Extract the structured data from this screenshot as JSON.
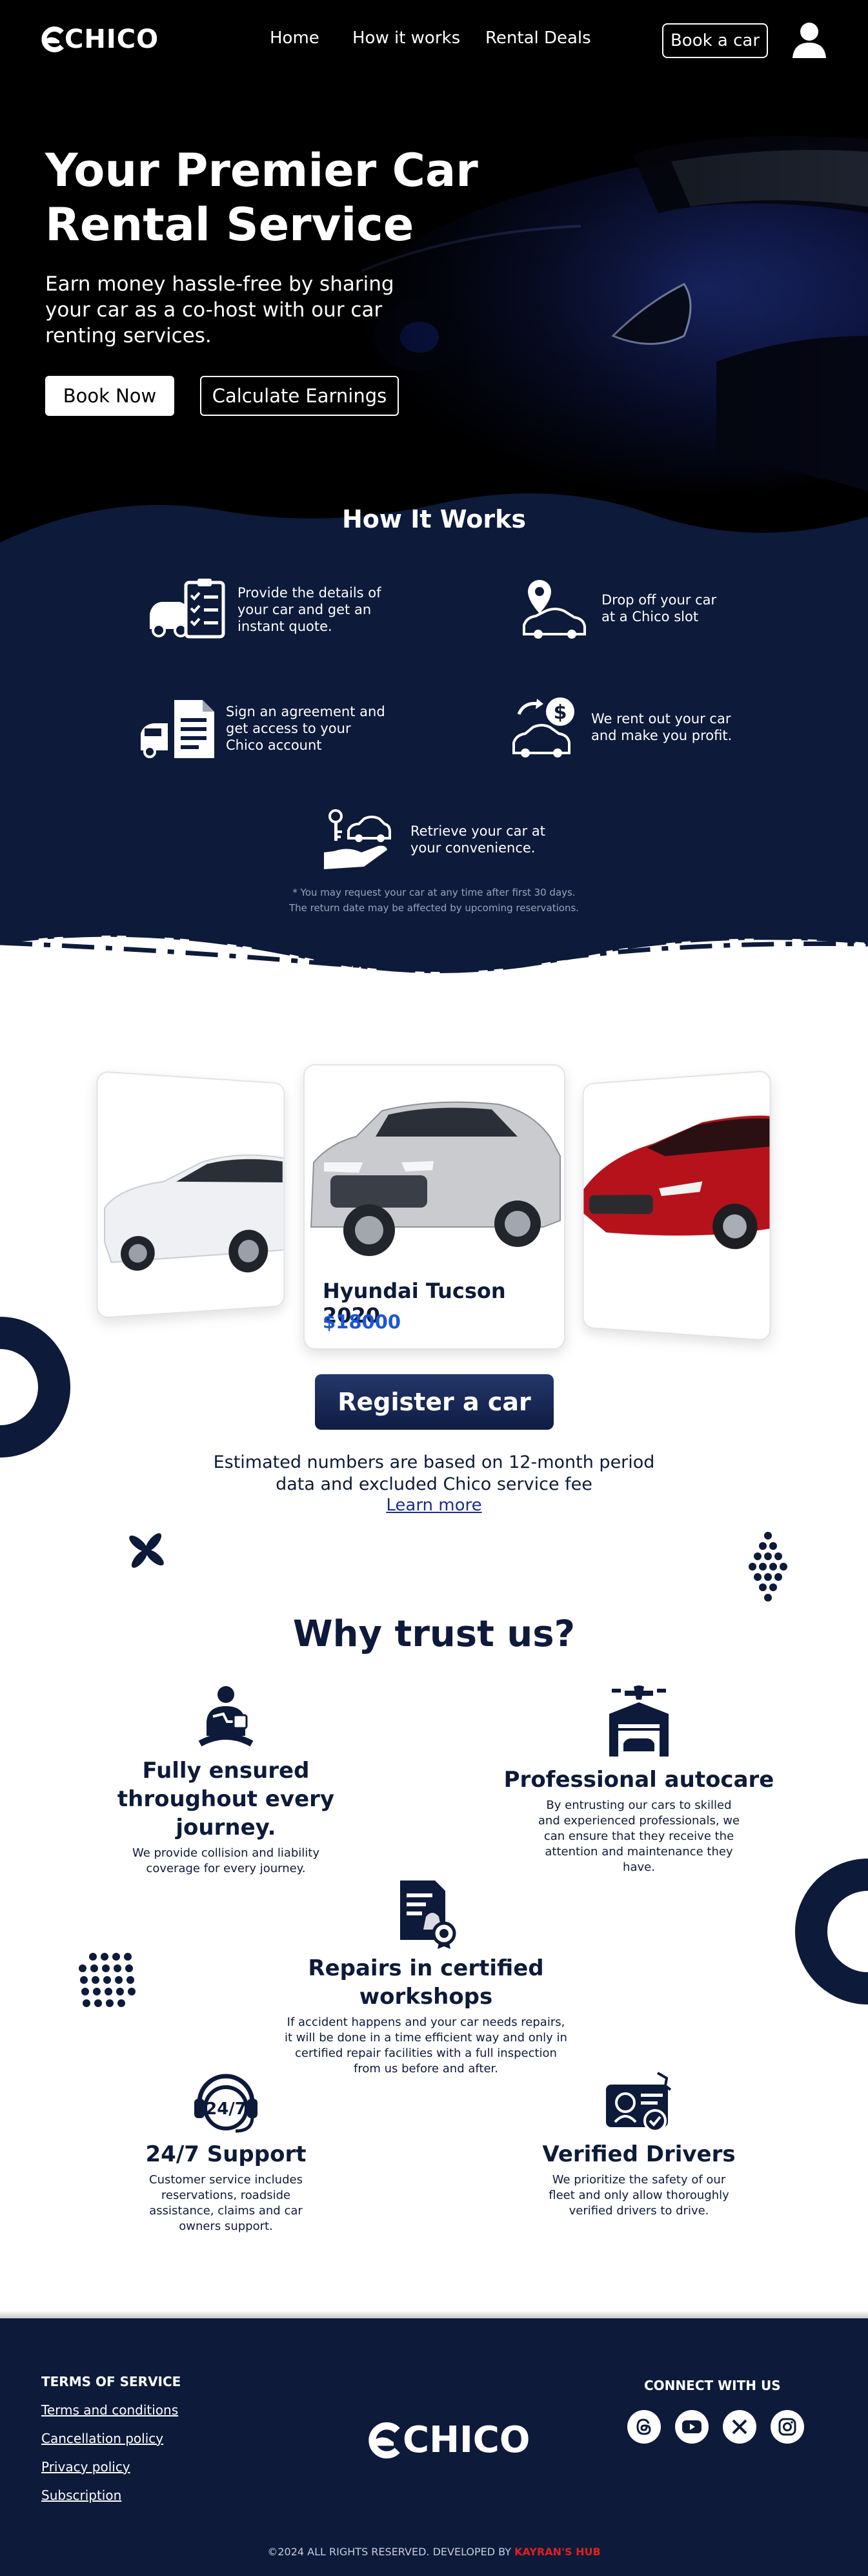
{
  "brand": {
    "name": "CHICO"
  },
  "nav": {
    "home": "Home",
    "how_it_works": "How it works",
    "rental_deals": "Rental Deals",
    "book_a_car": "Book a car"
  },
  "hero": {
    "title_line1": "Your Premier Car",
    "title_line2": "Rental Service",
    "subtitle": "Earn money hassle-free by sharing your car as a co-host with our car renting services.",
    "book_now": "Book Now",
    "calculate": "Calculate Earnings"
  },
  "how": {
    "title": "How It Works",
    "steps": [
      {
        "icon": "car-checklist-icon",
        "text": "Provide the details of your car and get an instant quote."
      },
      {
        "icon": "location-car-icon",
        "text": "Drop off your car at a Chico slot"
      },
      {
        "icon": "agreement-document-icon",
        "text": "Sign an agreement and get access to your Chico account"
      },
      {
        "icon": "car-money-icon",
        "text": "We rent out your car and make you profit."
      },
      {
        "icon": "key-hand-car-icon",
        "text": "Retrieve your car at your convenience."
      }
    ],
    "note_line1": "* You may request your car at any time after first 30 days.",
    "note_line2": "The return date may be affected by upcoming reservations."
  },
  "carousel": {
    "active_name": "Hyundai Tucson 2020",
    "active_price": "$18000",
    "colors": {
      "left": "#f2f3f5",
      "middle": "#c9cbcf",
      "right": "#b5121b"
    }
  },
  "register": {
    "button": "Register a car",
    "estimate": "Estimated numbers are based on 12-month period data and excluded Chico service fee",
    "learn_more": "Learn more"
  },
  "why": {
    "title": "Why trust us?",
    "features": [
      {
        "icon": "insured-person-icon",
        "title": "Fully ensured throughout every journey.",
        "desc": "We provide collision and liability coverage for every journey."
      },
      {
        "icon": "autocare-garage-icon",
        "title": "Professional autocare",
        "desc": "By entrusting our cars to skilled and experienced professionals, we can ensure that they receive the attention and maintenance they have."
      },
      {
        "icon": "certified-document-icon",
        "title": "Repairs in certified workshops",
        "desc": "If accident happens and your car needs repairs, it will be done in a time efficient way and only in certified repair facilities with a full inspection from us before and after."
      },
      {
        "icon": "support-24-7-icon",
        "title": "24/7 Support",
        "desc": "Customer service includes reservations, roadside assistance, claims and car owners support."
      },
      {
        "icon": "verified-license-icon",
        "title": "Verified Drivers",
        "desc": "We prioritize the safety of our fleet and only allow thoroughly verified drivers to drive."
      }
    ]
  },
  "footer": {
    "terms_title": "TERMS OF SERVICE",
    "links": [
      "Terms and conditions",
      "Cancellation policy",
      "Privacy policy",
      "Subscription"
    ],
    "connect": "CONNECT WITH US",
    "social": [
      "threads-icon",
      "youtube-icon",
      "x-icon",
      "instagram-icon"
    ],
    "copyright": "©2024 ALL RIGHTS RESERVED. DEVELOPED BY",
    "developer": "KAYRAN'S HUB"
  },
  "colors": {
    "navy": "#0d1a3a",
    "accent_blue": "#1a56d6",
    "developer_red": "#e02020"
  }
}
